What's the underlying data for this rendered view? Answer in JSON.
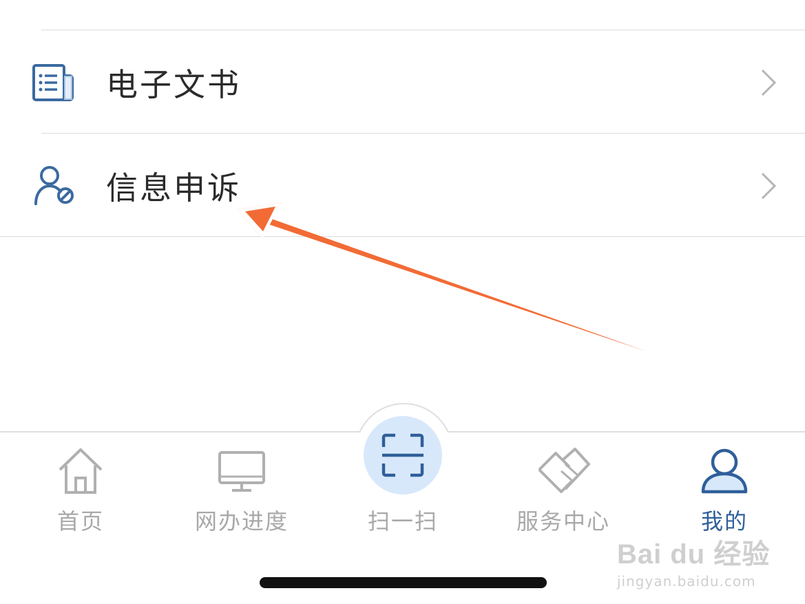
{
  "menu": {
    "items": [
      {
        "label": "电子文书",
        "icon": "document-icon"
      },
      {
        "label": "信息申诉",
        "icon": "user-appeal-icon"
      }
    ]
  },
  "tabbar": {
    "tabs": [
      {
        "label": "首页",
        "icon": "home-icon",
        "active": false
      },
      {
        "label": "网办进度",
        "icon": "monitor-icon",
        "active": false
      },
      {
        "label": "扫一扫",
        "icon": "scan-icon",
        "active": false
      },
      {
        "label": "服务中心",
        "icon": "handshake-icon",
        "active": false
      },
      {
        "label": "我的",
        "icon": "user-icon",
        "active": true
      }
    ]
  },
  "annotation": {
    "arrow_color": "#f26b35"
  },
  "watermark": {
    "brand": "Bai du 经验",
    "url": "jingyan.baidu.com"
  },
  "colors": {
    "accent": "#2f5f9a",
    "inactive": "#a8a8a8",
    "scan_bg": "#d8e8fb"
  }
}
